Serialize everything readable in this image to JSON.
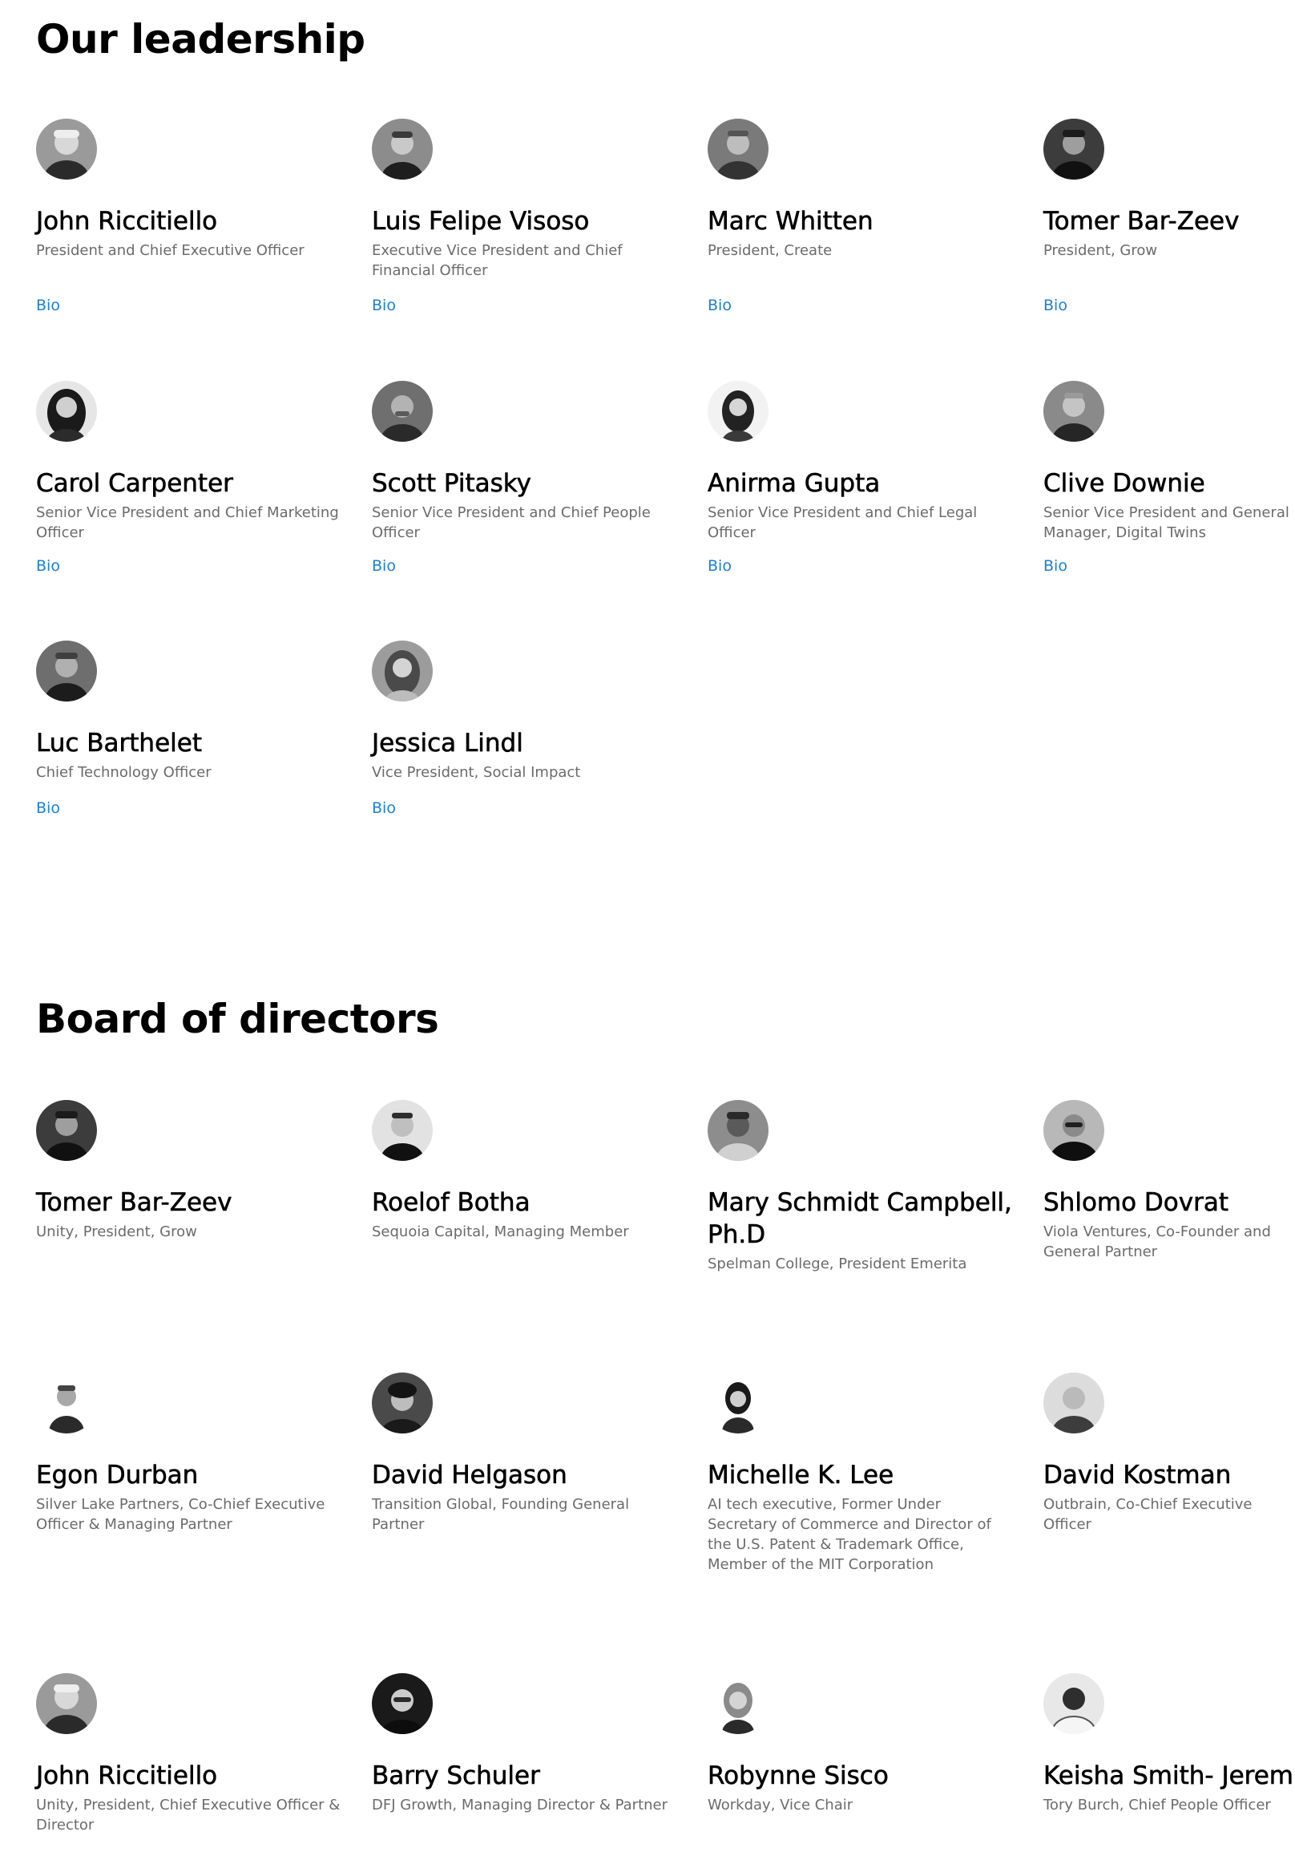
{
  "leadership": {
    "title": "Our leadership",
    "bio_label": "Bio",
    "members": [
      {
        "name": "John Riccitiello",
        "role": "President and Chief Executive Officer"
      },
      {
        "name": "Luis Felipe Visoso",
        "role": "Executive Vice President and Chief Financial Officer"
      },
      {
        "name": "Marc Whitten",
        "role": "President, Create"
      },
      {
        "name": "Tomer Bar-Zeev",
        "role": "President, Grow"
      },
      {
        "name": "Carol Carpenter",
        "role": "Senior Vice President and Chief Marketing Officer"
      },
      {
        "name": "Scott Pitasky",
        "role": "Senior Vice President and Chief People Officer"
      },
      {
        "name": "Anirma Gupta",
        "role": "Senior Vice President and Chief Legal Officer"
      },
      {
        "name": "Clive Downie",
        "role": "Senior Vice President and General Manager, Digital Twins"
      },
      {
        "name": "Luc Barthelet",
        "role": "Chief Technology Officer"
      },
      {
        "name": "Jessica Lindl",
        "role": "Vice President, Social Impact"
      }
    ]
  },
  "board": {
    "title": "Board of directors",
    "members": [
      {
        "name": "Tomer Bar-Zeev",
        "role": "Unity, President, Grow"
      },
      {
        "name": "Roelof Botha",
        "role": "Sequoia Capital, Managing Member"
      },
      {
        "name": "Mary Schmidt Campbell, Ph.D",
        "role": "Spelman College, President Emerita"
      },
      {
        "name": "Shlomo Dovrat",
        "role": "Viola Ventures, Co-Founder and General Partner"
      },
      {
        "name": "Egon Durban",
        "role": "Silver Lake Partners, Co-Chief Executive Officer & Managing Partner"
      },
      {
        "name": "David Helgason",
        "role": "Transition Global, Founding General Partner"
      },
      {
        "name": "Michelle K. Lee",
        "role": "AI tech executive, Former Under Secretary of Commerce and Director of the U.S. Patent & Trademark Office, Member of the MIT Corporation"
      },
      {
        "name": "David Kostman",
        "role": "Outbrain, Co-Chief Executive Officer"
      },
      {
        "name": "John Riccitiello",
        "role": "Unity, President, Chief Executive Officer & Director"
      },
      {
        "name": "Barry Schuler",
        "role": "DFJ Growth, Managing Director & Partner"
      },
      {
        "name": "Robynne Sisco",
        "role": "Workday, Vice Chair"
      },
      {
        "name": "Keisha Smith- Jeremie",
        "role": "Tory Burch, Chief People Officer"
      }
    ]
  }
}
